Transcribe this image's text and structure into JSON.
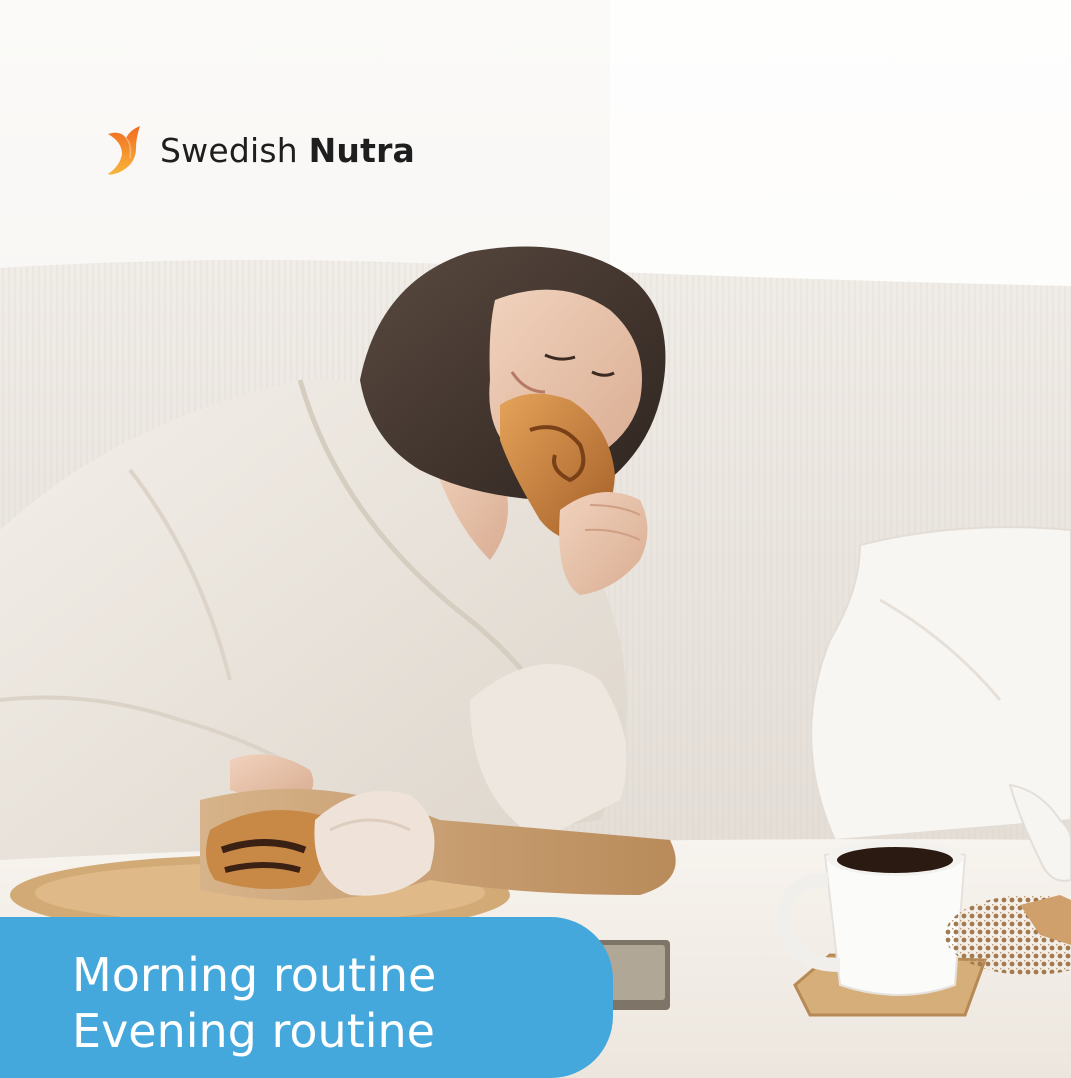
{
  "brand": {
    "name_regular": "Swedish",
    "name_bold": "Nutra",
    "logo_icon": "swallow-flame-mark",
    "colors": {
      "logo_top": "#f26b21",
      "logo_bottom": "#f7b53a",
      "text": "#1e1e1e"
    }
  },
  "banner": {
    "line_1": "Morning routine",
    "line_2": "Evening routine",
    "color": "#45a8dc",
    "text_color": "#ffffff"
  },
  "photo": {
    "palette": {
      "wall": "#f6f4f1",
      "sofa": "#ece7e1",
      "robe": "#eee9e2",
      "table": "#f4f0ea",
      "pastry": "#c8823e",
      "coffee": "#2b1a12"
    }
  }
}
